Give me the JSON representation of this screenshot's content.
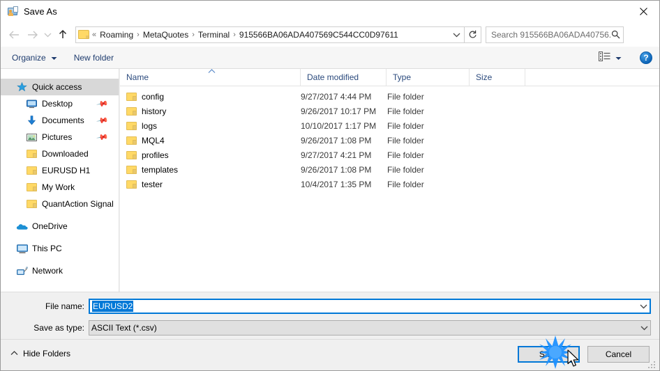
{
  "window": {
    "title": "Save As",
    "app_icon": "save-as-icon",
    "close_icon": "close-icon"
  },
  "nav": {
    "back_icon": "back-arrow-icon",
    "forward_icon": "forward-arrow-icon",
    "recent_icon": "recent-locations-chevron-icon",
    "up_icon": "up-arrow-icon",
    "address": {
      "folder_icon": "folder-icon",
      "prefix": "«",
      "crumbs": [
        "Roaming",
        "MetaQuotes",
        "Terminal",
        "915566BA06ADA407569C544CC0D97611"
      ],
      "separator": "›",
      "dropdown_icon": "chevron-down-icon"
    },
    "refresh_icon": "refresh-icon",
    "search": {
      "placeholder": "Search 915566BA06ADA40756...",
      "icon": "search-icon"
    }
  },
  "toolbar": {
    "organize_label": "Organize",
    "organize_caret_icon": "caret-down-icon",
    "new_folder_label": "New folder",
    "view_mode_icon": "view-mode-icon",
    "view_mode_caret_icon": "caret-down-icon",
    "help_label": "?",
    "help_icon": "help-icon"
  },
  "sidebar": {
    "items": [
      {
        "label": "Quick access",
        "icon": "quick-access-star-icon",
        "level": 0,
        "selected": true,
        "pinned": false
      },
      {
        "label": "Desktop",
        "icon": "desktop-icon",
        "level": 1,
        "selected": false,
        "pinned": true
      },
      {
        "label": "Documents",
        "icon": "documents-download-icon",
        "level": 1,
        "selected": false,
        "pinned": true
      },
      {
        "label": "Pictures",
        "icon": "pictures-icon",
        "level": 1,
        "selected": false,
        "pinned": true
      },
      {
        "label": "Downloaded",
        "icon": "folder-icon",
        "level": 1,
        "selected": false,
        "pinned": false
      },
      {
        "label": "EURUSD H1",
        "icon": "folder-icon",
        "level": 1,
        "selected": false,
        "pinned": false
      },
      {
        "label": "My Work",
        "icon": "folder-icon",
        "level": 1,
        "selected": false,
        "pinned": false
      },
      {
        "label": "QuantAction Signal",
        "icon": "folder-icon",
        "level": 1,
        "selected": false,
        "pinned": false
      },
      {
        "label": "OneDrive",
        "icon": "onedrive-cloud-icon",
        "level": 0,
        "selected": false,
        "pinned": false,
        "gap_before": true
      },
      {
        "label": "This PC",
        "icon": "this-pc-icon",
        "level": 0,
        "selected": false,
        "pinned": false,
        "gap_before": true
      },
      {
        "label": "Network",
        "icon": "network-icon",
        "level": 0,
        "selected": false,
        "pinned": false,
        "gap_before": true
      }
    ]
  },
  "filelist": {
    "columns": [
      "Name",
      "Date modified",
      "Type",
      "Size"
    ],
    "sort_indicator_icon": "sort-ascending-icon",
    "rows": [
      {
        "name": "config",
        "date": "9/27/2017 4:44 PM",
        "type": "File folder",
        "size": "",
        "icon": "folder-icon"
      },
      {
        "name": "history",
        "date": "9/26/2017 10:17 PM",
        "type": "File folder",
        "size": "",
        "icon": "folder-icon"
      },
      {
        "name": "logs",
        "date": "10/10/2017 1:17 PM",
        "type": "File folder",
        "size": "",
        "icon": "folder-icon"
      },
      {
        "name": "MQL4",
        "date": "9/26/2017 1:08 PM",
        "type": "File folder",
        "size": "",
        "icon": "folder-icon"
      },
      {
        "name": "profiles",
        "date": "9/27/2017 4:21 PM",
        "type": "File folder",
        "size": "",
        "icon": "folder-icon"
      },
      {
        "name": "templates",
        "date": "9/26/2017 1:08 PM",
        "type": "File folder",
        "size": "",
        "icon": "folder-icon"
      },
      {
        "name": "tester",
        "date": "10/4/2017 1:35 PM",
        "type": "File folder",
        "size": "",
        "icon": "folder-icon"
      }
    ]
  },
  "form": {
    "file_name_label": "File name:",
    "file_name_value": "EURUSD2",
    "file_name_dropdown_icon": "chevron-down-icon",
    "save_as_type_label": "Save as type:",
    "save_as_type_value": "ASCII Text (*.csv)",
    "save_as_type_dropdown_icon": "chevron-down-icon"
  },
  "footer": {
    "hide_folders_label": "Hide Folders",
    "hide_folders_icon": "chevron-up-icon",
    "save_label": "Save",
    "cancel_label": "Cancel",
    "resize_grip_icon": "resize-grip-icon",
    "click_burst_icon": "click-burst-icon",
    "cursor_icon": "mouse-pointer-icon"
  },
  "colors": {
    "accent": "#0078d7",
    "selection_text_bg": "#0078d7",
    "sidebar_selected_bg": "#d8d8d8",
    "folder_yellow": "#ffd966",
    "column_header_text": "#2b4a7d",
    "toolbar_link": "#1f3c6e",
    "burst_blue": "#1e90ff"
  }
}
